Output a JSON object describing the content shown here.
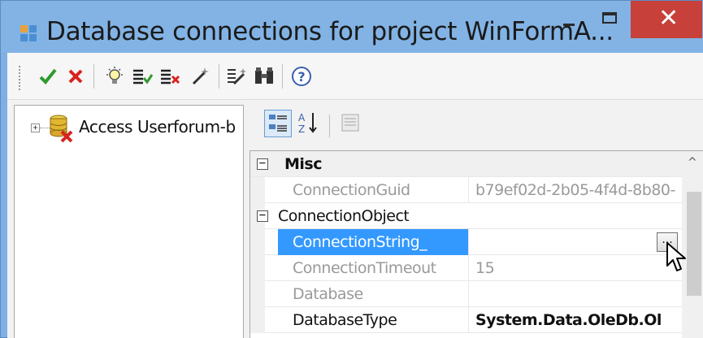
{
  "window": {
    "title": "Database connections for project WinFormA...",
    "controls": {
      "minimize": "minimize",
      "maximize": "maximize",
      "close": "✕"
    }
  },
  "toolbar": {
    "buttons": [
      {
        "name": "accept",
        "icon": "checkmark-icon"
      },
      {
        "name": "cancel",
        "icon": "red-x-icon"
      },
      {
        "name": "new-connection",
        "icon": "lightbulb-icon"
      },
      {
        "name": "test-ok",
        "icon": "list-check-icon"
      },
      {
        "name": "delete",
        "icon": "list-delete-icon"
      },
      {
        "name": "edit",
        "icon": "wand-icon"
      },
      {
        "name": "wizard",
        "icon": "magic-list-icon"
      },
      {
        "name": "find",
        "icon": "binoculars-icon"
      },
      {
        "name": "help",
        "icon": "help-icon"
      }
    ]
  },
  "tree": {
    "expand_symbol": "+",
    "items": [
      {
        "label": "Access Userforum-b"
      }
    ]
  },
  "propertygrid": {
    "toolbar": {
      "categorized_icon": "categorized-icon",
      "alphabetical_icon": "alphabetical-icon",
      "pages_icon": "property-pages-icon"
    },
    "category": {
      "toggle": "−",
      "label": "Misc"
    },
    "rows": [
      {
        "name": "ConnectionGuid",
        "value": "b79ef02d-2b05-4f4d-8b80-"
      },
      {
        "toggle": "−",
        "name": "ConnectionObject",
        "value": ""
      },
      {
        "name": "ConnectionString_",
        "value": "",
        "button": "..."
      },
      {
        "name": "ConnectionTimeout",
        "value": "15"
      },
      {
        "name": "Database",
        "value": ""
      },
      {
        "name": "DatabaseType",
        "value": "System.Data.OleDb.Ol"
      }
    ],
    "scroll_up": "^"
  },
  "colors": {
    "titlebar": "#82b3e4",
    "close": "#c7403a",
    "selection": "#3399ff"
  }
}
